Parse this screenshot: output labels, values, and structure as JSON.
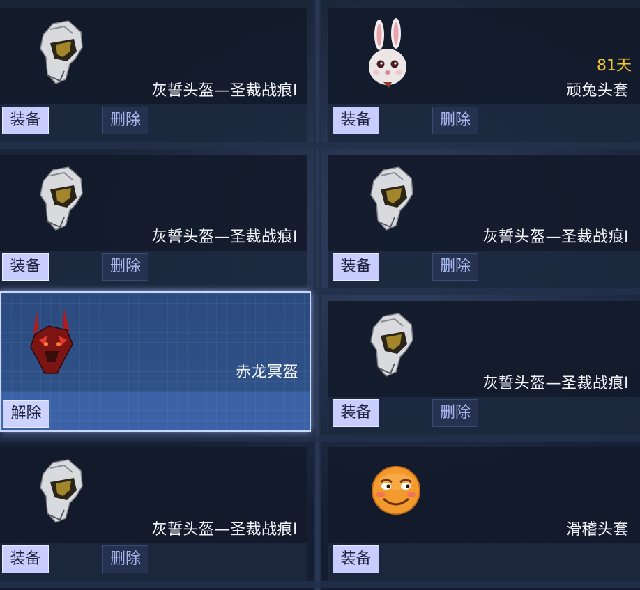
{
  "items": [
    {
      "name": "灰誓头盔—圣裁战痕Ⅰ",
      "icon": "helmet-icon",
      "primary_label": "装备",
      "delete_label": "删除",
      "days": "",
      "selected": false
    },
    {
      "name": "顽兔头套",
      "icon": "rabbit-mask-icon",
      "primary_label": "装备",
      "delete_label": "删除",
      "days": "81天",
      "selected": false
    },
    {
      "name": "灰誓头盔—圣裁战痕Ⅰ",
      "icon": "helmet-icon",
      "primary_label": "装备",
      "delete_label": "删除",
      "days": "",
      "selected": false
    },
    {
      "name": "灰誓头盔—圣裁战痕Ⅰ",
      "icon": "helmet-icon",
      "primary_label": "装备",
      "delete_label": "删除",
      "days": "",
      "selected": false
    },
    {
      "name": "赤龙冥盔",
      "icon": "red-dragon-helmet-icon",
      "primary_label": "解除",
      "delete_label": "",
      "days": "",
      "selected": true
    },
    {
      "name": "灰誓头盔—圣裁战痕Ⅰ",
      "icon": "helmet-icon",
      "primary_label": "装备",
      "delete_label": "删除",
      "days": "",
      "selected": false
    },
    {
      "name": "灰誓头盔—圣裁战痕Ⅰ",
      "icon": "helmet-icon",
      "primary_label": "装备",
      "delete_label": "删除",
      "days": "",
      "selected": false
    },
    {
      "name": "滑稽头套",
      "icon": "funny-face-mask-icon",
      "primary_label": "装备",
      "delete_label": "",
      "days": "",
      "selected": false
    }
  ],
  "colors": {
    "days_text": "#f4c531",
    "equip_button": "#c8cdfd",
    "selected_border": "#c9d6ff"
  }
}
